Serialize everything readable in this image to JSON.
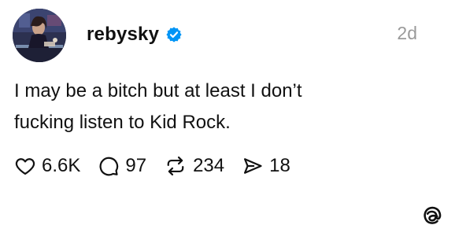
{
  "author": {
    "username": "rebysky",
    "verified": true,
    "avatar": "profile-photo"
  },
  "time": "2d",
  "post": {
    "text_line1": "I may be a bitch but at least I don’t",
    "text_line2": "fucking listen to Kid Rock."
  },
  "actions": {
    "likes": "6.6K",
    "replies": "97",
    "reposts": "234",
    "shares": "18"
  },
  "icons": {
    "like": "heart-icon",
    "reply": "speech-bubble-icon",
    "repost": "repost-arrows-icon",
    "share": "paper-plane-icon",
    "brand": "threads-logo-icon"
  },
  "colors": {
    "text": "#111111",
    "muted": "#9a9a9a",
    "verified": "#0095f6"
  }
}
